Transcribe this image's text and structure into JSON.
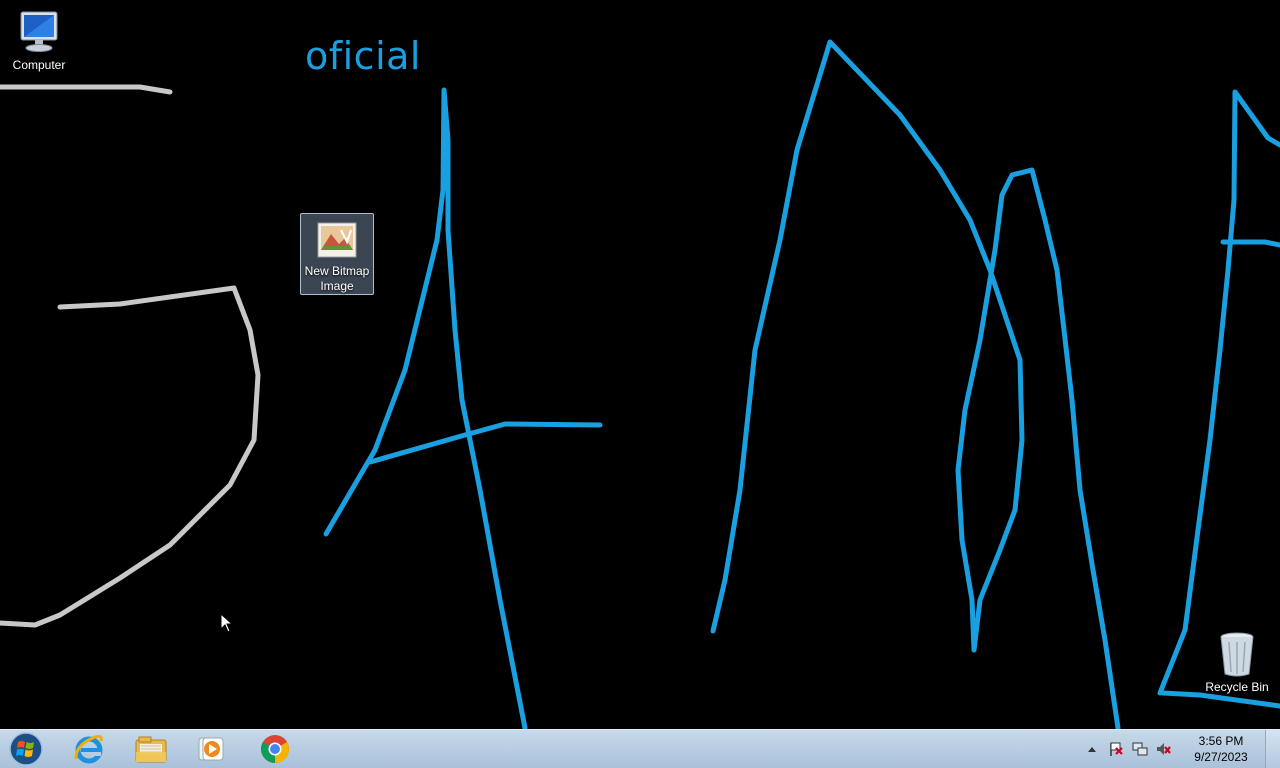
{
  "desktop": {
    "wallpaper_text": "oficial",
    "icons": [
      {
        "label": "Computer",
        "icon": "computer-icon"
      },
      {
        "label": "New Bitmap Image",
        "icon": "bitmap-image-icon",
        "selected": true
      },
      {
        "label": "Recycle Bin",
        "icon": "recycle-bin-icon"
      }
    ]
  },
  "taskbar": {
    "start_icon": "windows-start-orb",
    "pinned": [
      {
        "name": "Internet Explorer",
        "icon": "internet-explorer-icon"
      },
      {
        "name": "Windows Explorer",
        "icon": "file-explorer-icon"
      },
      {
        "name": "Windows Media Player",
        "icon": "media-player-icon"
      },
      {
        "name": "Google Chrome",
        "icon": "chrome-icon"
      }
    ],
    "tray_icons": [
      "show-hidden-icons-arrow",
      "action-center-flag-icon",
      "network-icon",
      "volume-muted-icon"
    ],
    "clock": {
      "time": "3:56 PM",
      "date": "9/27/2023"
    }
  },
  "colors": {
    "wallpaper_bg": "#000000",
    "stroke_blue": "#1a9fe0",
    "stroke_gray": "#c8c8c8",
    "taskbar": "#b7cde3"
  }
}
